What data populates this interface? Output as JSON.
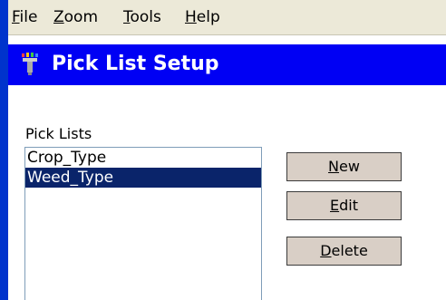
{
  "menu": {
    "items": [
      {
        "accel": "F",
        "rest": "ile"
      },
      {
        "accel": "Z",
        "rest": "oom"
      },
      {
        "accel": "T",
        "rest": "ools"
      },
      {
        "accel": "H",
        "rest": "elp"
      }
    ]
  },
  "window": {
    "title": "Pick List Setup",
    "icon": "pick-list-app-icon"
  },
  "pick_lists": {
    "label": "Pick Lists",
    "items": [
      "Crop_Type",
      "Weed_Type"
    ],
    "selected_index": 1
  },
  "buttons": {
    "new": {
      "accel": "N",
      "rest": "ew"
    },
    "edit": {
      "accel": "E",
      "rest": "dit"
    },
    "delete": {
      "accel": "D",
      "rest": "elete"
    }
  },
  "colors": {
    "title_bar": "#0000f4",
    "selection": "#0a246a",
    "button_face": "#d9cfc6"
  }
}
